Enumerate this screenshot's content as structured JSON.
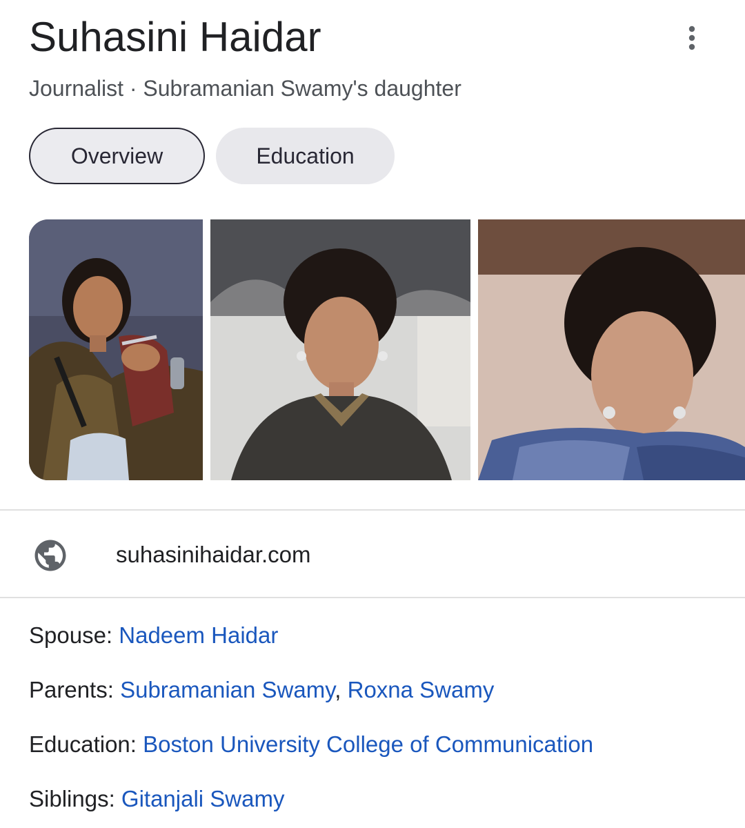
{
  "entity": {
    "title": "Suhasini Haidar",
    "subtitle": "Journalist · Subramanian Swamy's daughter"
  },
  "more_icon": "more-vert-icon",
  "tabs": [
    {
      "label": "Overview",
      "active": true
    },
    {
      "label": "Education",
      "active": false
    }
  ],
  "images": [
    {
      "name": "photo-1"
    },
    {
      "name": "photo-2"
    },
    {
      "name": "photo-3"
    }
  ],
  "website": {
    "icon": "globe-icon",
    "text": "suhasinihaidar.com"
  },
  "facts": {
    "spouse": {
      "label": "Spouse: ",
      "value": "Nadeem Haidar"
    },
    "parents": {
      "label": "Parents: ",
      "values": [
        "Subramanian Swamy",
        "Roxna Swamy"
      ],
      "separator": ", "
    },
    "education": {
      "label": "Education: ",
      "value": "Boston University College of Communication"
    },
    "siblings": {
      "label": "Siblings: ",
      "value": "Gitanjali Swamy"
    }
  },
  "colors": {
    "link": "#1a57bd",
    "text": "#202124",
    "secondary_text": "#4d5156",
    "tab_active_bg": "#ebebef",
    "tab_border": "#282734",
    "divider": "#e0e0e0"
  }
}
